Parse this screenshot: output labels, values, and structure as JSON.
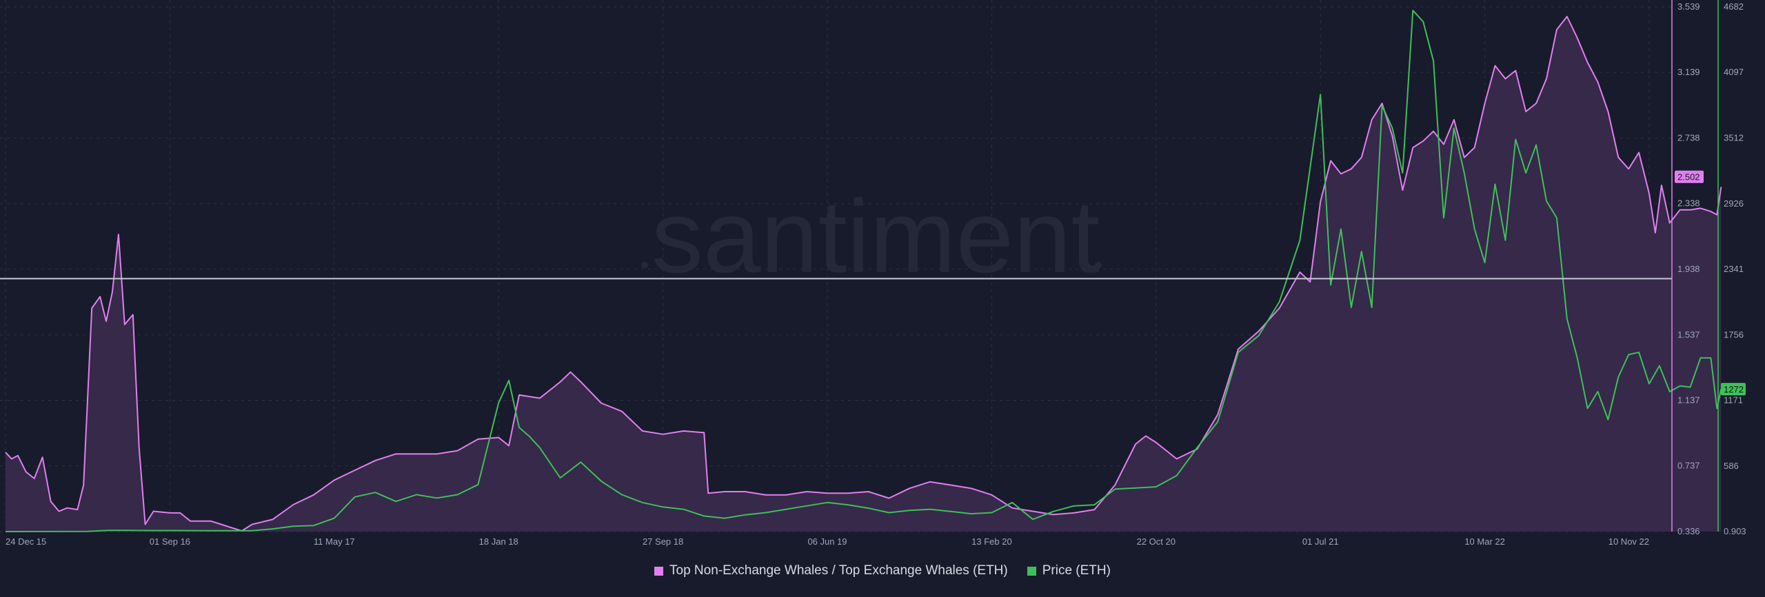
{
  "watermark": "santiment",
  "colors": {
    "background": "#181b2b",
    "ratio": "#e27ff0",
    "ratio_fill": "#3a2b4d",
    "price": "#3fbf5a",
    "grid": "#2b3044",
    "reference_line": "#c7cad6",
    "axis_text": "#9fa6bc"
  },
  "legend": {
    "items": [
      {
        "label": "Top Non-Exchange Whales / Top Exchange Whales (ETH)",
        "color": "#e27ff0"
      },
      {
        "label": "Price (ETH)",
        "color": "#3fbf5a"
      }
    ]
  },
  "chart_data": {
    "type": "line",
    "title": "",
    "x_tick_labels": [
      "24 Dec 15",
      "01 Sep 16",
      "11 May 17",
      "18 Jan 18",
      "27 Sep 18",
      "06 Jun 19",
      "13 Feb 20",
      "22 Oct 20",
      "01 Jul 21",
      "10 Mar 22",
      "10 Nov 22"
    ],
    "x_tick_positions": [
      0,
      8,
      16,
      24,
      32,
      40,
      48,
      56,
      64,
      72,
      80
    ],
    "x_range": [
      0,
      80
    ],
    "y_ratio": {
      "label": "",
      "range": [
        0.336,
        3.539
      ],
      "ticks": [
        3.539,
        3.139,
        2.738,
        2.338,
        1.938,
        1.537,
        1.137,
        0.737,
        0.336
      ],
      "current_value_label": "2.502"
    },
    "y_price": {
      "label": "",
      "range": [
        0.903,
        4682
      ],
      "ticks": [
        4682,
        4097,
        3512,
        2926,
        2341,
        1756,
        1171,
        586,
        0.903
      ],
      "current_value_label": "1272"
    },
    "reference_line": 1.88,
    "grid": true,
    "legend_position": "bottom-center",
    "series": [
      {
        "name": "Top Non-Exchange Whales / Top Exchange Whales (ETH)",
        "axis": "ratio",
        "fill": true,
        "points": [
          [
            0,
            0.82
          ],
          [
            0.3,
            0.78
          ],
          [
            0.6,
            0.8
          ],
          [
            1,
            0.7
          ],
          [
            1.4,
            0.66
          ],
          [
            1.8,
            0.79
          ],
          [
            2.2,
            0.52
          ],
          [
            2.6,
            0.46
          ],
          [
            3,
            0.48
          ],
          [
            3.5,
            0.47
          ],
          [
            3.8,
            0.62
          ],
          [
            4.2,
            1.7
          ],
          [
            4.6,
            1.77
          ],
          [
            4.9,
            1.62
          ],
          [
            5.2,
            1.8
          ],
          [
            5.5,
            2.15
          ],
          [
            5.8,
            1.6
          ],
          [
            6.2,
            1.66
          ],
          [
            6.5,
            0.85
          ],
          [
            6.8,
            0.38
          ],
          [
            7.2,
            0.46
          ],
          [
            8,
            0.45
          ],
          [
            8.5,
            0.45
          ],
          [
            9,
            0.4
          ],
          [
            10,
            0.4
          ],
          [
            10.5,
            0.38
          ],
          [
            11,
            0.36
          ],
          [
            11.5,
            0.34
          ],
          [
            12,
            0.38
          ],
          [
            13,
            0.41
          ],
          [
            14,
            0.5
          ],
          [
            15,
            0.56
          ],
          [
            16,
            0.65
          ],
          [
            17,
            0.71
          ],
          [
            18,
            0.77
          ],
          [
            19,
            0.81
          ],
          [
            20,
            0.81
          ],
          [
            21,
            0.81
          ],
          [
            22,
            0.83
          ],
          [
            23,
            0.9
          ],
          [
            24,
            0.91
          ],
          [
            24.5,
            0.86
          ],
          [
            25,
            1.17
          ],
          [
            26,
            1.15
          ],
          [
            27,
            1.25
          ],
          [
            27.5,
            1.31
          ],
          [
            28,
            1.25
          ],
          [
            29,
            1.12
          ],
          [
            30,
            1.07
          ],
          [
            31,
            0.95
          ],
          [
            32,
            0.93
          ],
          [
            33,
            0.95
          ],
          [
            34,
            0.94
          ],
          [
            34.2,
            0.57
          ],
          [
            35,
            0.58
          ],
          [
            36,
            0.58
          ],
          [
            37,
            0.56
          ],
          [
            38,
            0.56
          ],
          [
            39,
            0.58
          ],
          [
            40,
            0.57
          ],
          [
            41,
            0.57
          ],
          [
            42,
            0.58
          ],
          [
            43,
            0.54
          ],
          [
            44,
            0.6
          ],
          [
            45,
            0.64
          ],
          [
            46,
            0.62
          ],
          [
            47,
            0.6
          ],
          [
            48,
            0.56
          ],
          [
            49,
            0.48
          ],
          [
            50,
            0.46
          ],
          [
            51,
            0.44
          ],
          [
            52,
            0.45
          ],
          [
            53,
            0.47
          ],
          [
            54,
            0.62
          ],
          [
            55,
            0.87
          ],
          [
            55.5,
            0.92
          ],
          [
            56,
            0.88
          ],
          [
            57,
            0.78
          ],
          [
            58,
            0.84
          ],
          [
            59,
            1.05
          ],
          [
            60,
            1.45
          ],
          [
            61,
            1.56
          ],
          [
            62,
            1.7
          ],
          [
            63,
            1.92
          ],
          [
            63.5,
            1.86
          ],
          [
            64,
            2.35
          ],
          [
            64.5,
            2.6
          ],
          [
            65,
            2.52
          ],
          [
            65.5,
            2.55
          ],
          [
            66,
            2.62
          ],
          [
            66.5,
            2.85
          ],
          [
            67,
            2.95
          ],
          [
            67.5,
            2.75
          ],
          [
            68,
            2.42
          ],
          [
            68.5,
            2.68
          ],
          [
            69,
            2.72
          ],
          [
            69.5,
            2.78
          ],
          [
            70,
            2.7
          ],
          [
            70.5,
            2.85
          ],
          [
            71,
            2.62
          ],
          [
            71.5,
            2.68
          ],
          [
            72,
            2.95
          ],
          [
            72.5,
            3.18
          ],
          [
            73,
            3.1
          ],
          [
            73.5,
            3.15
          ],
          [
            74,
            2.9
          ],
          [
            74.5,
            2.95
          ],
          [
            75,
            3.1
          ],
          [
            75.5,
            3.4
          ],
          [
            76,
            3.48
          ],
          [
            76.5,
            3.35
          ],
          [
            77,
            3.2
          ],
          [
            77.5,
            3.08
          ],
          [
            78,
            2.9
          ],
          [
            78.5,
            2.62
          ],
          [
            79,
            2.55
          ],
          [
            79.5,
            2.65
          ],
          [
            80,
            2.4
          ],
          [
            80.3,
            2.16
          ],
          [
            80.6,
            2.45
          ],
          [
            81,
            2.22
          ],
          [
            81.5,
            2.3
          ],
          [
            82,
            2.3
          ],
          [
            82.5,
            2.31
          ],
          [
            83,
            2.29
          ],
          [
            83.3,
            2.27
          ],
          [
            83.5,
            2.44
          ]
        ]
      },
      {
        "name": "Price (ETH)",
        "axis": "price",
        "fill": false,
        "points": [
          [
            0,
            1
          ],
          [
            4,
            2
          ],
          [
            5,
            12
          ],
          [
            6,
            12
          ],
          [
            7,
            10
          ],
          [
            8,
            10
          ],
          [
            10,
            9
          ],
          [
            12,
            9
          ],
          [
            13,
            25
          ],
          [
            14,
            48
          ],
          [
            15,
            55
          ],
          [
            16,
            120
          ],
          [
            17,
            310
          ],
          [
            18,
            350
          ],
          [
            19,
            270
          ],
          [
            20,
            330
          ],
          [
            21,
            300
          ],
          [
            22,
            330
          ],
          [
            23,
            420
          ],
          [
            24,
            1150
          ],
          [
            24.5,
            1350
          ],
          [
            25,
            930
          ],
          [
            25.5,
            850
          ],
          [
            26,
            750
          ],
          [
            27,
            480
          ],
          [
            28,
            620
          ],
          [
            29,
            450
          ],
          [
            30,
            330
          ],
          [
            31,
            260
          ],
          [
            32,
            220
          ],
          [
            33,
            200
          ],
          [
            34,
            140
          ],
          [
            35,
            120
          ],
          [
            36,
            150
          ],
          [
            37,
            170
          ],
          [
            38,
            200
          ],
          [
            39,
            230
          ],
          [
            40,
            260
          ],
          [
            41,
            240
          ],
          [
            42,
            210
          ],
          [
            43,
            170
          ],
          [
            44,
            190
          ],
          [
            45,
            200
          ],
          [
            46,
            180
          ],
          [
            47,
            160
          ],
          [
            48,
            170
          ],
          [
            49,
            260
          ],
          [
            50,
            110
          ],
          [
            51,
            180
          ],
          [
            52,
            230
          ],
          [
            53,
            240
          ],
          [
            54,
            380
          ],
          [
            55,
            390
          ],
          [
            56,
            400
          ],
          [
            57,
            500
          ],
          [
            58,
            750
          ],
          [
            59,
            980
          ],
          [
            60,
            1600
          ],
          [
            61,
            1750
          ],
          [
            62,
            2050
          ],
          [
            63,
            2600
          ],
          [
            64,
            3900
          ],
          [
            64.5,
            2200
          ],
          [
            65,
            2700
          ],
          [
            65.5,
            2000
          ],
          [
            66,
            2500
          ],
          [
            66.5,
            2000
          ],
          [
            67,
            3800
          ],
          [
            67.5,
            3600
          ],
          [
            68,
            3200
          ],
          [
            68.5,
            4650
          ],
          [
            69,
            4550
          ],
          [
            69.5,
            4200
          ],
          [
            70,
            2800
          ],
          [
            70.5,
            3600
          ],
          [
            71,
            3200
          ],
          [
            71.5,
            2700
          ],
          [
            72,
            2400
          ],
          [
            72.5,
            3100
          ],
          [
            73,
            2600
          ],
          [
            73.5,
            3500
          ],
          [
            74,
            3200
          ],
          [
            74.5,
            3450
          ],
          [
            75,
            2950
          ],
          [
            75.5,
            2800
          ],
          [
            76,
            1900
          ],
          [
            76.5,
            1550
          ],
          [
            77,
            1100
          ],
          [
            77.5,
            1250
          ],
          [
            78,
            1000
          ],
          [
            78.5,
            1380
          ],
          [
            79,
            1580
          ],
          [
            79.5,
            1600
          ],
          [
            80,
            1320
          ],
          [
            80.5,
            1480
          ],
          [
            81,
            1250
          ],
          [
            81.5,
            1300
          ],
          [
            82,
            1290
          ],
          [
            82.5,
            1550
          ],
          [
            83,
            1550
          ],
          [
            83.3,
            1100
          ],
          [
            83.5,
            1272
          ]
        ]
      }
    ]
  }
}
